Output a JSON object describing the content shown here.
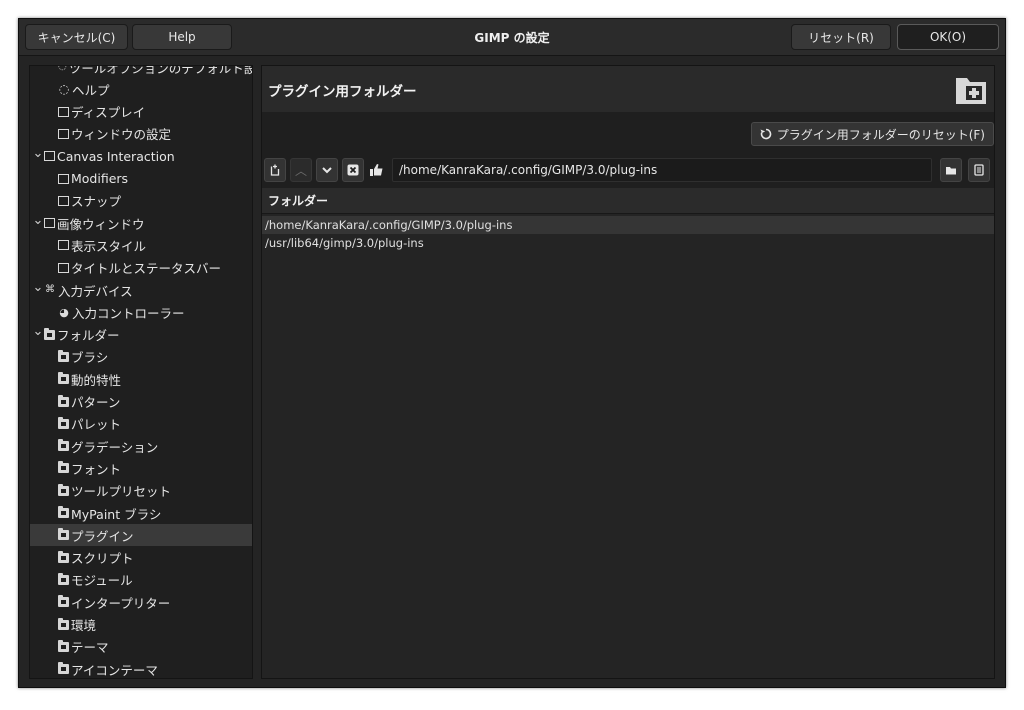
{
  "window": {
    "title": "GIMP の設定",
    "cancel_label": "キャンセル(C)",
    "help_label": "Help",
    "reset_label": "リセット(R)",
    "ok_label": "OK(O)"
  },
  "sidebar": {
    "items": [
      {
        "label": "ツールオプションのデフォルト設定",
        "level": 1,
        "icon": "tool-options-icon",
        "partial": true
      },
      {
        "label": "ヘルプ",
        "level": 1,
        "icon": "help-lifebuoy-icon"
      },
      {
        "label": "ディスプレイ",
        "level": 1,
        "icon": "display-monitor-icon"
      },
      {
        "label": "ウィンドウの設定",
        "level": 1,
        "icon": "window-management-icon"
      },
      {
        "label": "Canvas Interaction",
        "level": 0,
        "icon": "canvas-interaction-icon",
        "expanded": true
      },
      {
        "label": "Modifiers",
        "level": 1,
        "icon": "modifiers-icon"
      },
      {
        "label": "スナップ",
        "level": 1,
        "icon": "snap-icon"
      },
      {
        "label": "画像ウィンドウ",
        "level": 0,
        "icon": "image-window-icon",
        "expanded": true
      },
      {
        "label": "表示スタイル",
        "level": 1,
        "icon": "appearance-icon"
      },
      {
        "label": "タイトルとステータスバー",
        "level": 1,
        "icon": "title-statusbar-icon"
      },
      {
        "label": "入力デバイス",
        "level": 0,
        "icon": "input-devices-icon",
        "expanded": true
      },
      {
        "label": "入力コントローラー",
        "level": 1,
        "icon": "input-controllers-icon"
      },
      {
        "label": "フォルダー",
        "level": 0,
        "icon": "folders-icon",
        "expanded": true
      },
      {
        "label": "ブラシ",
        "level": 1,
        "icon": "folder-brushes-icon"
      },
      {
        "label": "動的特性",
        "level": 1,
        "icon": "folder-dynamics-icon"
      },
      {
        "label": "パターン",
        "level": 1,
        "icon": "folder-patterns-icon"
      },
      {
        "label": "パレット",
        "level": 1,
        "icon": "folder-palettes-icon"
      },
      {
        "label": "グラデーション",
        "level": 1,
        "icon": "folder-gradients-icon"
      },
      {
        "label": "フォント",
        "level": 1,
        "icon": "folder-fonts-icon"
      },
      {
        "label": "ツールプリセット",
        "level": 1,
        "icon": "folder-tool-presets-icon"
      },
      {
        "label": "MyPaint ブラシ",
        "level": 1,
        "icon": "folder-mypaint-brushes-icon"
      },
      {
        "label": "プラグイン",
        "level": 1,
        "icon": "folder-plugins-icon",
        "selected": true
      },
      {
        "label": "スクリプト",
        "level": 1,
        "icon": "folder-scripts-icon"
      },
      {
        "label": "モジュール",
        "level": 1,
        "icon": "folder-modules-icon"
      },
      {
        "label": "インタープリター",
        "level": 1,
        "icon": "folder-interpreters-icon"
      },
      {
        "label": "環境",
        "level": 1,
        "icon": "folder-environment-icon"
      },
      {
        "label": "テーマ",
        "level": 1,
        "icon": "folder-themes-icon"
      },
      {
        "label": "アイコンテーマ",
        "level": 1,
        "icon": "folder-icon-themes-icon"
      }
    ]
  },
  "main": {
    "page_title": "プラグイン用フォルダー",
    "reset_button_label": "プラグイン用フォルダーのリセット(F)",
    "path_value": "/home/KanraKara/.config/GIMP/3.0/plug-ins",
    "list_header": "フォルダー",
    "rows": [
      {
        "path": "/home/KanraKara/.config/GIMP/3.0/plug-ins",
        "selected": true
      },
      {
        "path": "/usr/lib64/gimp/3.0/plug-ins",
        "selected": false
      }
    ]
  },
  "colors": {
    "window_bg": "#242424",
    "panel_bg": "#1f1f1f",
    "header_bg": "#2a2a2a",
    "selection_bg": "#3a3a3a",
    "text": "#e6e6e6"
  }
}
